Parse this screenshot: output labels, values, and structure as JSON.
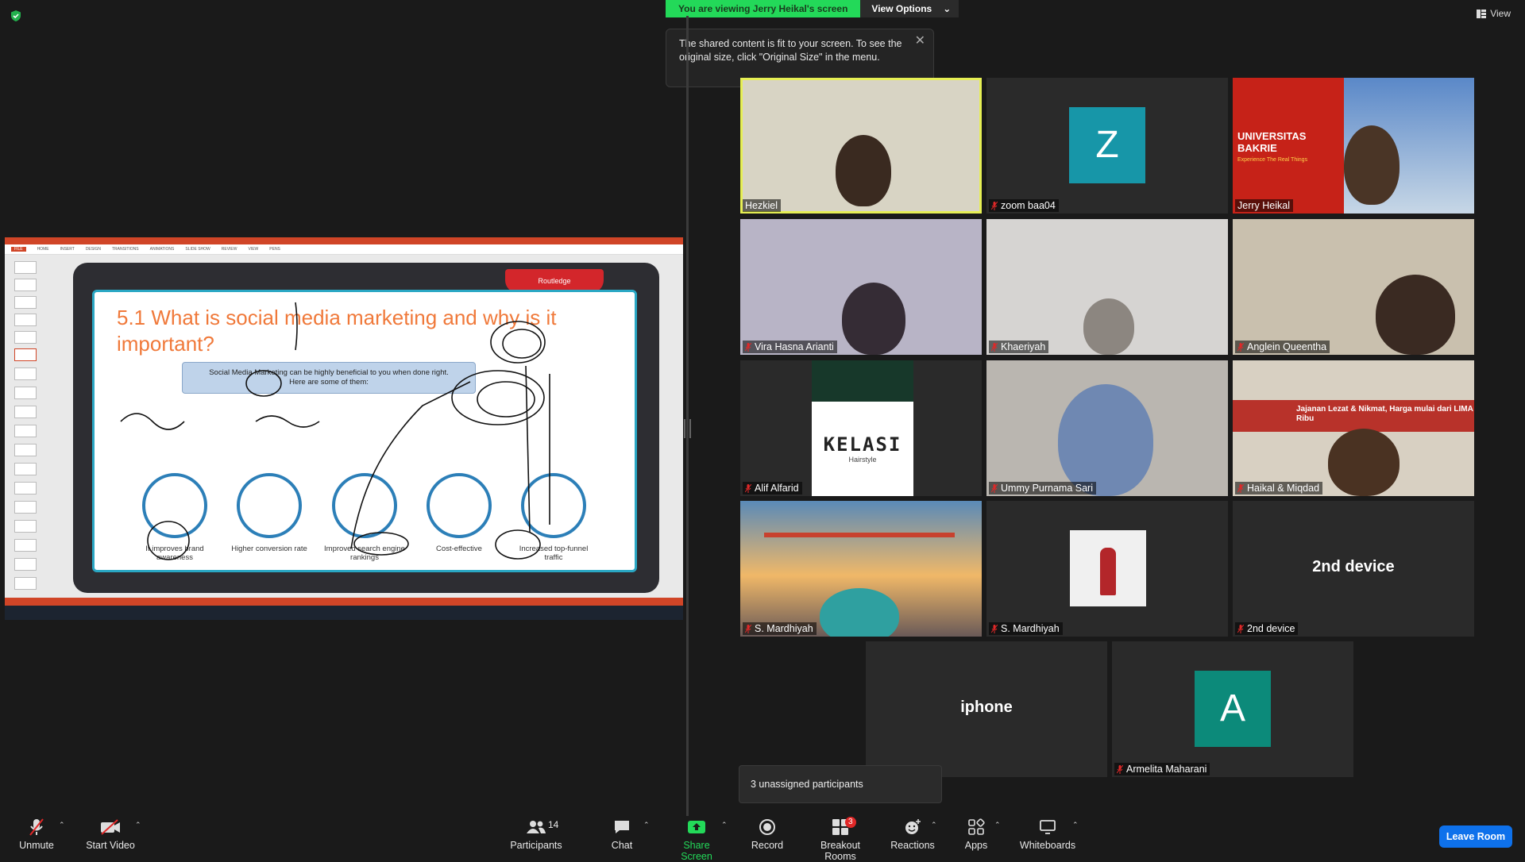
{
  "banner": {
    "viewing_text": "You are viewing Jerry Heikal's screen",
    "view_options": "View Options"
  },
  "tooltip": {
    "text": "The shared content is fit to your screen. To see the original size, click \"Original Size\" in the menu."
  },
  "top_right": {
    "view_label": "View"
  },
  "slide": {
    "title": "5.1 What is social media marketing and why is it important?",
    "callout_line1": "Social Media Marketing can be highly beneficial to you when done right.",
    "callout_line2": "Here are some of them:",
    "publisher": "Routledge",
    "benefits": [
      "It improves brand awareness",
      "Higher conversion rate",
      "Improved search engine rankings",
      "Cost-effective",
      "Increased top-funnel traffic"
    ]
  },
  "participants": [
    {
      "name": "Hezkiel",
      "muted": false,
      "active": true
    },
    {
      "name": "zoom baa04",
      "muted": true,
      "avatar": "Z"
    },
    {
      "name": "Jerry Heikal",
      "muted": false
    },
    {
      "name": "Vira Hasna Arianti",
      "muted": true
    },
    {
      "name": "Khaeriyah",
      "muted": true
    },
    {
      "name": "Anglein Queentha",
      "muted": true
    },
    {
      "name": "Alif Alfarid",
      "muted": true
    },
    {
      "name": "Ummy Purnama Sari",
      "muted": true
    },
    {
      "name": "Haikal & Miqdad",
      "muted": true
    },
    {
      "name": "S. Mardhiyah",
      "muted": true
    },
    {
      "name": "S. Mardhiyah",
      "muted": true
    },
    {
      "name": "2nd device",
      "muted": true,
      "big_label": "2nd device"
    },
    {
      "name": "iphone",
      "muted": true,
      "big_label": "iphone"
    },
    {
      "name": "Armelita Maharani",
      "muted": true,
      "avatar": "A"
    }
  ],
  "tile_texts": {
    "jerry_univ": "UNIVERSITAS BAKRIE",
    "jerry_tag": "Experience The Real Things",
    "kelasi": "KELASI",
    "kelasi_sub": "Hairstyle",
    "haikal_sign": "Jajanan Lezat & Nikmat, Harga mulai dari LIMA Ribu"
  },
  "unassigned": "3 unassigned participants",
  "toolbar": {
    "unmute": "Unmute",
    "start_video": "Start Video",
    "participants": "Participants",
    "participants_count": "14",
    "chat": "Chat",
    "share_screen": "Share Screen",
    "record": "Record",
    "breakout": "Breakout Rooms",
    "breakout_badge": "3",
    "reactions": "Reactions",
    "apps": "Apps",
    "whiteboards": "Whiteboards",
    "leave": "Leave Room"
  },
  "colors": {
    "banner_green": "#23d959",
    "active_speaker": "#e6ef54",
    "avatar_teal": "#1796a8",
    "avatar_green": "#0c8a7a",
    "share_green": "#23d959",
    "leave_blue": "#0e71eb",
    "muted_red": "#e02828"
  }
}
